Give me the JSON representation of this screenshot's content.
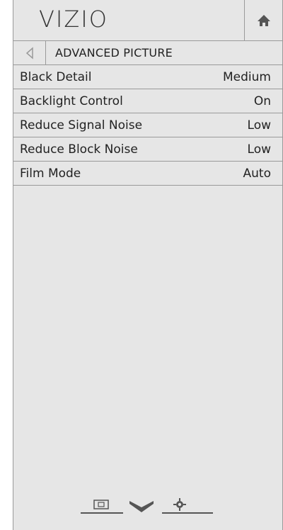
{
  "header": {
    "logo": "VIZIO",
    "home_icon": "home-icon"
  },
  "subheader": {
    "back_icon": "back-triangle-icon",
    "title": "ADVANCED PICTURE"
  },
  "settings": [
    {
      "label": "Black Detail",
      "value": "Medium"
    },
    {
      "label": "Backlight Control",
      "value": "On"
    },
    {
      "label": "Reduce Signal Noise",
      "value": "Low"
    },
    {
      "label": "Reduce Block Noise",
      "value": "Low"
    },
    {
      "label": "Film Mode",
      "value": "Auto"
    }
  ],
  "bottom_nav": {
    "icons": [
      "input-icon",
      "chevron-down-icon",
      "gear-icon"
    ]
  }
}
